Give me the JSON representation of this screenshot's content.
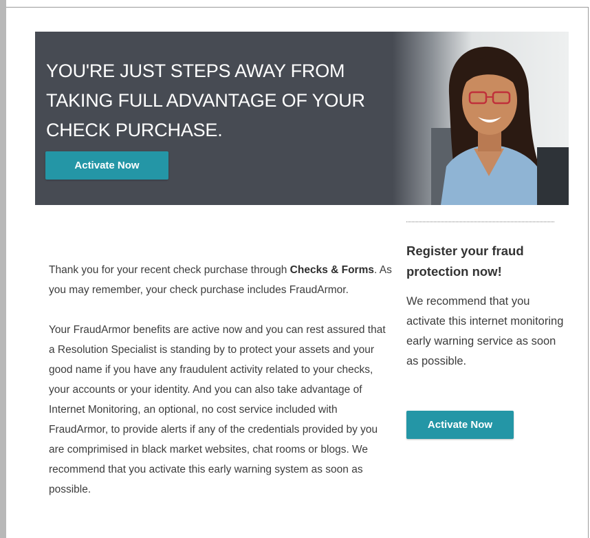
{
  "hero": {
    "headline": "YOU'RE JUST STEPS AWAY FROM TAKING FULL ADVANTAGE OF YOUR CHECK PURCHASE.",
    "button_label": "Activate Now"
  },
  "main": {
    "p1_before": "Thank you for your recent check purchase through ",
    "p1_bold": "Checks & Forms",
    "p1_after": ". As you may remember, your check purchase includes FraudArmor.",
    "p2": "Your FraudArmor benefits are active now and you can rest assured that a Resolution Specialist is standing by to protect your assets and your good name if you have any fraudulent activity related to your checks, your accounts or your identity. And you can also take advantage of Internet Monitoring, an optional, no cost service included with FraudArmor, to provide alerts if any of the credentials provided by you are comprimised in black market websites, chat rooms or blogs. We recommend that you activate this early warning system as soon as possible."
  },
  "sidebar": {
    "title": "Register your fraud protection now!",
    "text": "We recommend that you activate this internet monitoring early warning service as soon as possible.",
    "button_label": "Activate Now"
  },
  "colors": {
    "hero_bg": "#474b53",
    "button": "#2496a6"
  }
}
